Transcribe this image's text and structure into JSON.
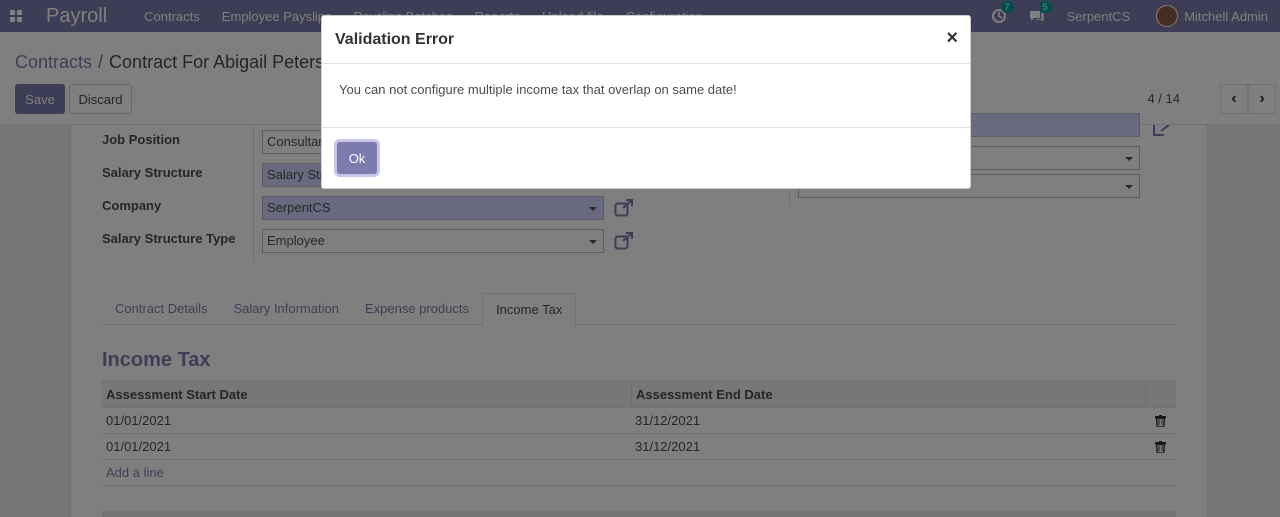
{
  "navbar": {
    "brand": "Payroll",
    "menu": [
      "Contracts",
      "Employee Payslips",
      "Payslips Batches",
      "Reports",
      "Upload file",
      "Configuration"
    ],
    "activity_count": "7",
    "message_count": "5",
    "company": "SerpentCS",
    "user": "Mitchell Admin"
  },
  "control_panel": {
    "breadcrumb_parent": "Contracts",
    "breadcrumb_separator": "/",
    "breadcrumb_current": "Contract For Abigail Peterson",
    "save_label": "Save",
    "discard_label": "Discard",
    "pager": "4 / 14"
  },
  "form": {
    "job_position_label": "Job Position",
    "job_position_value": "Consultant",
    "salary_structure_label": "Salary Structure",
    "salary_structure_value": "Salary Structure",
    "company_label": "Company",
    "company_value": "SerpentCS",
    "structure_type_label": "Salary Structure Type",
    "structure_type_value": "Employee"
  },
  "tabs": [
    "Contract Details",
    "Salary Information",
    "Expense products",
    "Income Tax"
  ],
  "income_tax": {
    "title": "Income Tax",
    "columns": [
      "Assessment Start Date",
      "Assessment End Date"
    ],
    "rows": [
      {
        "start": "01/01/2021",
        "end": "31/12/2021"
      },
      {
        "start": "01/01/2021",
        "end": "31/12/2021"
      }
    ],
    "add_line": "Add a line"
  },
  "modal": {
    "title": "Validation Error",
    "close": "×",
    "message": "You can not configure multiple income tax that overlap on same date!",
    "ok_label": "Ok"
  },
  "colors": {
    "brand": "#7c7bad",
    "required_field": "#d2d2ff"
  }
}
